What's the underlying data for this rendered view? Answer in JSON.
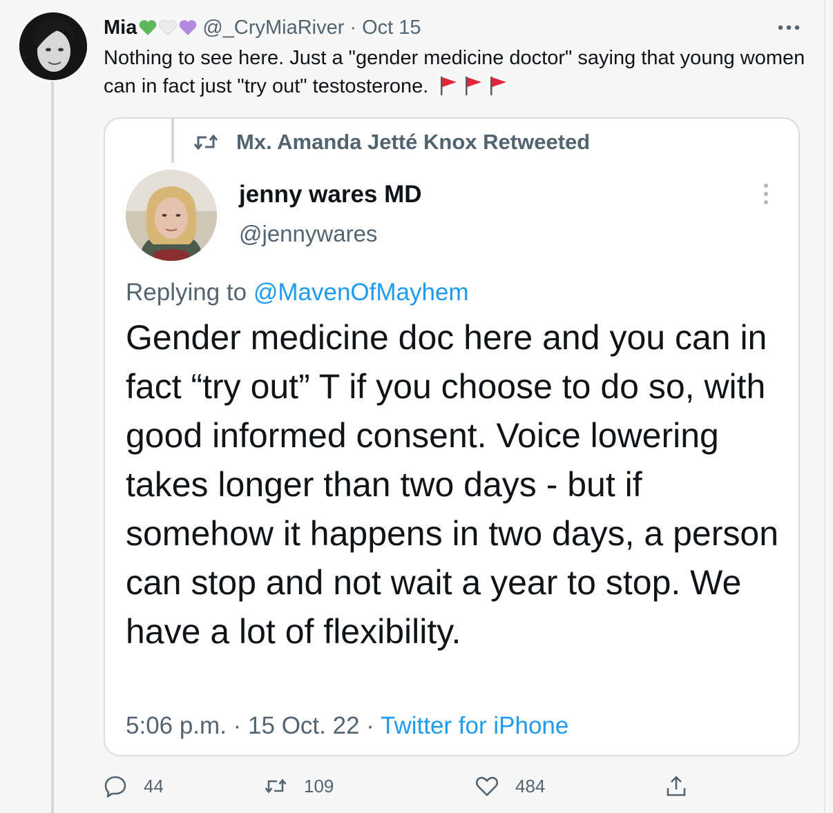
{
  "tweet": {
    "author_name": "Mia",
    "handle": "@_CryMiaRiver",
    "separator": "·",
    "date": "Oct 15",
    "hearts": [
      "green-heart",
      "white-heart",
      "purple-heart"
    ],
    "text": "Nothing to see here. Just a \"gender medicine doctor\" saying that young women can in fact just \"try out\" testosterone.",
    "emoji": [
      "red-flag",
      "red-flag",
      "red-flag"
    ],
    "more_icon": "more-dots-icon"
  },
  "quote": {
    "retweeted_by": "Mx. Amanda Jetté Knox Retweeted",
    "author_name": "jenny wares MD",
    "handle": "@jennywares",
    "replying_prefix": "Replying to",
    "replying_to": "@MavenOfMayhem",
    "body": "Gender medicine doc here and you can in fact “try out” T if you choose to do so, with good informed consent. Voice lowering takes longer than two days - but if somehow it happens in two days, a person can stop and not wait a year to stop. We have a lot of flexibility.",
    "time": "5:06 p.m.",
    "date": "15 Oct. 22",
    "separator": "·",
    "source": "Twitter for iPhone"
  },
  "actions": {
    "replies": "44",
    "retweets": "109",
    "likes": "484"
  },
  "colors": {
    "link": "#1d9bf0",
    "secondary_text": "#536471",
    "primary_text": "#0f1419",
    "flag_red": "#e0263a"
  }
}
